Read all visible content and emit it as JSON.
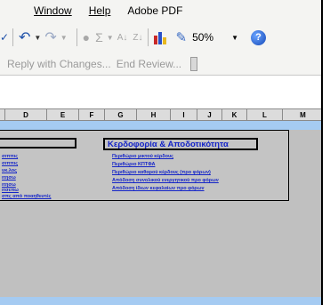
{
  "menu": {
    "window": "Window",
    "help": "Help",
    "adobe_pdf": "Adobe PDF"
  },
  "toolbar": {
    "undo_icon": "undo-icon",
    "redo_icon": "redo-icon",
    "sigma": "Σ",
    "sort_asc": "A↓",
    "sort_desc": "Z↓",
    "zoom": "50%",
    "help_glyph": "?"
  },
  "review": {
    "reply_with_changes": "Reply with Changes...",
    "end_review": "End Review..."
  },
  "columns": [
    "D",
    "E",
    "F",
    "G",
    "H",
    "I",
    "J",
    "K",
    "L",
    "M"
  ],
  "sheet": {
    "right_header": "Κερδοφορία & Αποδοτικότητα",
    "left_links": [
      "σιππις",
      "σιππις",
      "υκ.λος",
      "ιτησω",
      "ιτησω",
      "ιτσεπω",
      "σπς από ποαηθευτές"
    ],
    "right_links": [
      "Περιθώριο μικτού κέρδους",
      "Περιθώριο ΚΠΤΦΑ",
      "Περιθώριο καθαρού κέρδους (προ φόρων)",
      "Απόδοση συνολικού ενεργητικού προ φόρων",
      "Απόδοση ίδιων κεφαλαίων προ φόρων"
    ]
  },
  "colors": {
    "link": "#1424c8",
    "sheet_bg": "#c0c0c0",
    "band": "#a5cbf2"
  }
}
